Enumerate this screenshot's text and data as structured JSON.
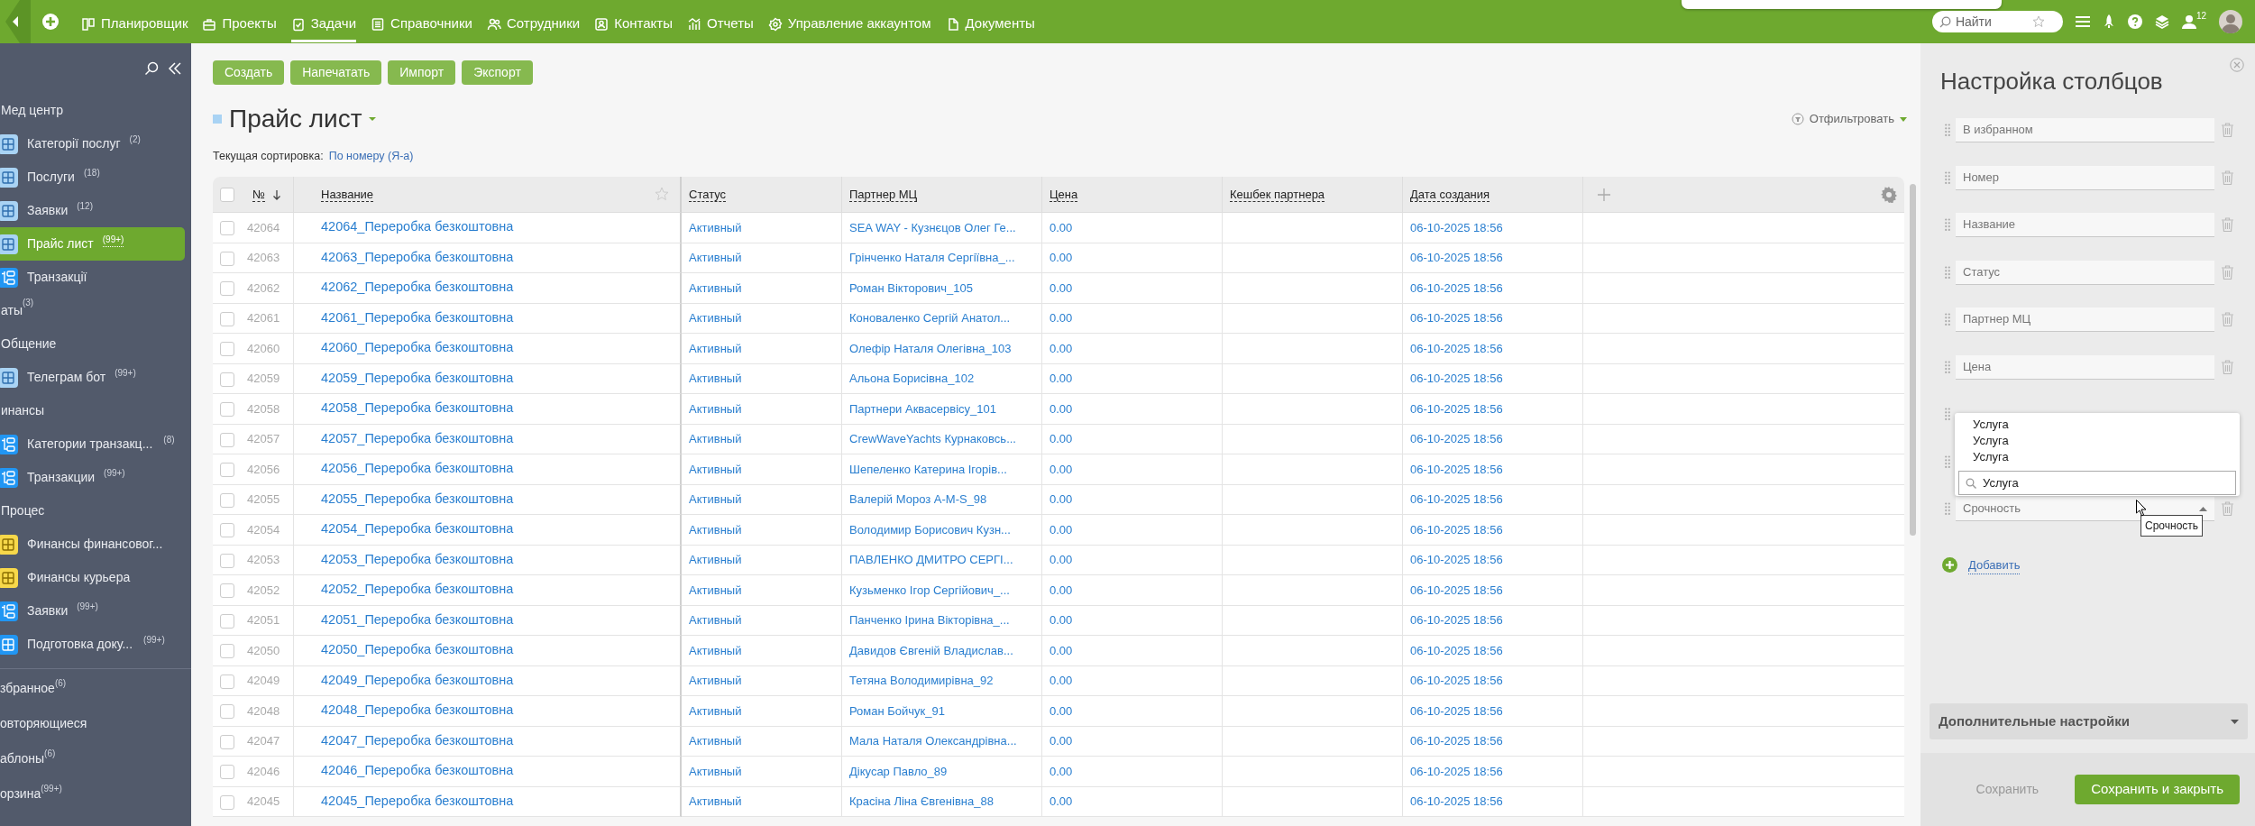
{
  "topbar": {
    "nav": [
      {
        "label": "Планировщик",
        "selected": false
      },
      {
        "label": "Проекты",
        "selected": false
      },
      {
        "label": "Задачи",
        "selected": true
      },
      {
        "label": "Справочники",
        "selected": false
      },
      {
        "label": "Сотрудники",
        "selected": false
      },
      {
        "label": "Контакты",
        "selected": false
      },
      {
        "label": "Отчеты",
        "selected": false
      },
      {
        "label": "Управление аккаунтом",
        "selected": false
      },
      {
        "label": "Документы",
        "selected": false
      }
    ],
    "search": {
      "placeholder": "Найти"
    },
    "notification_count": "12"
  },
  "sidebar": {
    "groups": [
      {
        "title": "Мед центр",
        "items": [
          {
            "label": "Категорії послуг",
            "count": "(2)",
            "kind": "grid",
            "color": "#a9d3f4",
            "selected": false
          },
          {
            "label": "Послуги",
            "count": "(18)",
            "kind": "grid",
            "color": "#a9d3f4",
            "selected": false
          },
          {
            "label": "Заявки",
            "count": "(12)",
            "kind": "grid",
            "color": "#a9d3f4",
            "selected": false
          },
          {
            "label": "Прайс лист",
            "count": "(99+)",
            "kind": "grid",
            "color": "#a9d3f4",
            "selected": true
          },
          {
            "label": "Транзакції",
            "kind": "flow",
            "color": "#2196f3",
            "selected": false
          }
        ]
      },
      {
        "title": "аты",
        "count": "(3)"
      },
      {
        "title": "Общение",
        "items": [
          {
            "label": "Телеграм бот",
            "count": "(99+)",
            "kind": "grid",
            "color": "#a9d3f4",
            "selected": false
          }
        ]
      },
      {
        "title": "инансы",
        "items": [
          {
            "label": "Категории транзакц...",
            "count": "(8)",
            "kind": "flow",
            "color": "#2196f3",
            "selected": false
          },
          {
            "label": "Транзакции",
            "count": "(99+)",
            "kind": "flow",
            "color": "#2196f3",
            "selected": false
          }
        ]
      },
      {
        "title": "Процес",
        "items": [
          {
            "label": "Финансы финансовог...",
            "kind": "grid",
            "color": "#f7d84a",
            "selected": false
          },
          {
            "label": "Финансы курьера",
            "kind": "grid",
            "color": "#f7d84a",
            "selected": false
          },
          {
            "label": "Заявки",
            "count": "(99+)",
            "kind": "flow",
            "color": "#2196f3",
            "selected": false
          },
          {
            "label": "Подготовка доку...",
            "count": "(99+)",
            "kind": "grid",
            "color": "#2196f3",
            "selected": false
          }
        ]
      }
    ],
    "links": [
      {
        "label": "збранное",
        "count": "(6)"
      },
      {
        "label": "овторяющиеся"
      },
      {
        "label": "аблоны",
        "count": "(6)"
      },
      {
        "label": "орзина",
        "count": "(99+)"
      }
    ]
  },
  "toolbar": {
    "buttons": [
      "Создать",
      "Напечатать",
      "Импорт",
      "Экспорт"
    ]
  },
  "page": {
    "title": "Прайс лист",
    "sort_label": "Текущая сортировка:",
    "sort_value": "По номеру (Я-а)",
    "filter": "Отфильтровать"
  },
  "table": {
    "all_selected": false,
    "columns": [
      {
        "label": "№",
        "sort_descending": true
      },
      {
        "label": "Название"
      },
      {
        "label": "Статус"
      },
      {
        "label": "Партнер МЦ"
      },
      {
        "label": "Цена"
      },
      {
        "label": "Кешбек партнера"
      },
      {
        "label": "Дата создания"
      }
    ],
    "rows": [
      {
        "selected": false,
        "number": "42064",
        "name": "42064_Переробка безкоштовна",
        "status": "Активный",
        "partner": "SEA WAY - Кузнєцов Олег Ге...",
        "price": "0.00",
        "date": "06-10-2025 18:56"
      },
      {
        "selected": false,
        "number": "42063",
        "name": "42063_Переробка безкоштовна",
        "status": "Активный",
        "partner": "Грінченко Наталя Сергіївна_...",
        "price": "0.00",
        "date": "06-10-2025 18:56"
      },
      {
        "selected": false,
        "number": "42062",
        "name": "42062_Переробка безкоштовна",
        "status": "Активный",
        "partner": "Роман Вікторович_105",
        "price": "0.00",
        "date": "06-10-2025 18:56"
      },
      {
        "selected": false,
        "number": "42061",
        "name": "42061_Переробка безкоштовна",
        "status": "Активный",
        "partner": "Коноваленко Сергій Анатол...",
        "price": "0.00",
        "date": "06-10-2025 18:56"
      },
      {
        "selected": false,
        "number": "42060",
        "name": "42060_Переробка безкоштовна",
        "status": "Активный",
        "partner": "Олефір Наталя Олегівна_103",
        "price": "0.00",
        "date": "06-10-2025 18:56"
      },
      {
        "selected": false,
        "number": "42059",
        "name": "42059_Переробка безкоштовна",
        "status": "Активный",
        "partner": "Альона Борисівна_102",
        "price": "0.00",
        "date": "06-10-2025 18:56"
      },
      {
        "selected": false,
        "number": "42058",
        "name": "42058_Переробка безкоштовна",
        "status": "Активный",
        "partner": "Партнери Аквасервісу_101",
        "price": "0.00",
        "date": "06-10-2025 18:56"
      },
      {
        "selected": false,
        "number": "42057",
        "name": "42057_Переробка безкоштовна",
        "status": "Активный",
        "partner": "CrewWaveYachts Курнаковсь...",
        "price": "0.00",
        "date": "06-10-2025 18:56"
      },
      {
        "selected": false,
        "number": "42056",
        "name": "42056_Переробка безкоштовна",
        "status": "Активный",
        "partner": "Шепеленко Катерина Ігорів...",
        "price": "0.00",
        "date": "06-10-2025 18:56"
      },
      {
        "selected": false,
        "number": "42055",
        "name": "42055_Переробка безкоштовна",
        "status": "Активный",
        "partner": "Валерій Мороз A-M-S_98",
        "price": "0.00",
        "date": "06-10-2025 18:56"
      },
      {
        "selected": false,
        "number": "42054",
        "name": "42054_Переробка безкоштовна",
        "status": "Активный",
        "partner": "Володимир Борисович Кузн...",
        "price": "0.00",
        "date": "06-10-2025 18:56"
      },
      {
        "selected": false,
        "number": "42053",
        "name": "42053_Переробка безкоштовна",
        "status": "Активный",
        "partner": "ПАВЛЕНКО ДМИТРО СЕРГІ...",
        "price": "0.00",
        "date": "06-10-2025 18:56"
      },
      {
        "selected": false,
        "number": "42052",
        "name": "42052_Переробка безкоштовна",
        "status": "Активный",
        "partner": "Кузьменко Ігор Сергійович_...",
        "price": "0.00",
        "date": "06-10-2025 18:56"
      },
      {
        "selected": false,
        "number": "42051",
        "name": "42051_Переробка безкоштовна",
        "status": "Активный",
        "partner": "Панченко Ірина Вікторівна_...",
        "price": "0.00",
        "date": "06-10-2025 18:56"
      },
      {
        "selected": false,
        "number": "42050",
        "name": "42050_Переробка безкоштовна",
        "status": "Активный",
        "partner": "Давидов Євгеній Владислав...",
        "price": "0.00",
        "date": "06-10-2025 18:56"
      },
      {
        "selected": false,
        "number": "42049",
        "name": "42049_Переробка безкоштовна",
        "status": "Активный",
        "partner": "Тетяна Володимирівна_92",
        "price": "0.00",
        "date": "06-10-2025 18:56"
      },
      {
        "selected": false,
        "number": "42048",
        "name": "42048_Переробка безкоштовна",
        "status": "Активный",
        "partner": "Роман Бойчук_91",
        "price": "0.00",
        "date": "06-10-2025 18:56"
      },
      {
        "selected": false,
        "number": "42047",
        "name": "42047_Переробка безкоштовна",
        "status": "Активный",
        "partner": "Мала Наталя Олександрівна...",
        "price": "0.00",
        "date": "06-10-2025 18:56"
      },
      {
        "selected": false,
        "number": "42046",
        "name": "42046_Переробка безкоштовна",
        "status": "Активный",
        "partner": "Дікусар Павло_89",
        "price": "0.00",
        "date": "06-10-2025 18:56"
      },
      {
        "selected": false,
        "number": "42045",
        "name": "42045_Переробка безкоштовна",
        "status": "Активный",
        "partner": "Красіна Ліна Євгенівна_88",
        "price": "0.00",
        "date": "06-10-2025 18:56"
      }
    ]
  },
  "panel": {
    "title": "Настройка столбцов",
    "fields": [
      {
        "kind": "field",
        "label": "В избранном",
        "expanded": false
      },
      {
        "kind": "field",
        "label": "Номер",
        "expanded": false
      },
      {
        "kind": "field",
        "label": "Название",
        "expanded": false
      },
      {
        "kind": "field",
        "label": "Статус",
        "expanded": false
      },
      {
        "kind": "field",
        "label": "Партнер МЦ",
        "expanded": false
      },
      {
        "kind": "field",
        "label": "Цена",
        "expanded": false
      },
      {
        "kind": "covered"
      },
      {
        "kind": "covered"
      },
      {
        "kind": "field",
        "label": "Срочность",
        "expanded": true
      }
    ],
    "dropdown": {
      "options": [
        "Услуга",
        "Услуга",
        "Услуга"
      ],
      "search_value": "Услуга"
    },
    "tooltip": "Срочность",
    "add_link": "Добавить",
    "advanced": "Дополнительные настройки",
    "buttons": [
      {
        "kind": "plain",
        "label": "Сохранить"
      },
      {
        "kind": "primary",
        "label": "Сохранить и закрыть"
      }
    ]
  }
}
